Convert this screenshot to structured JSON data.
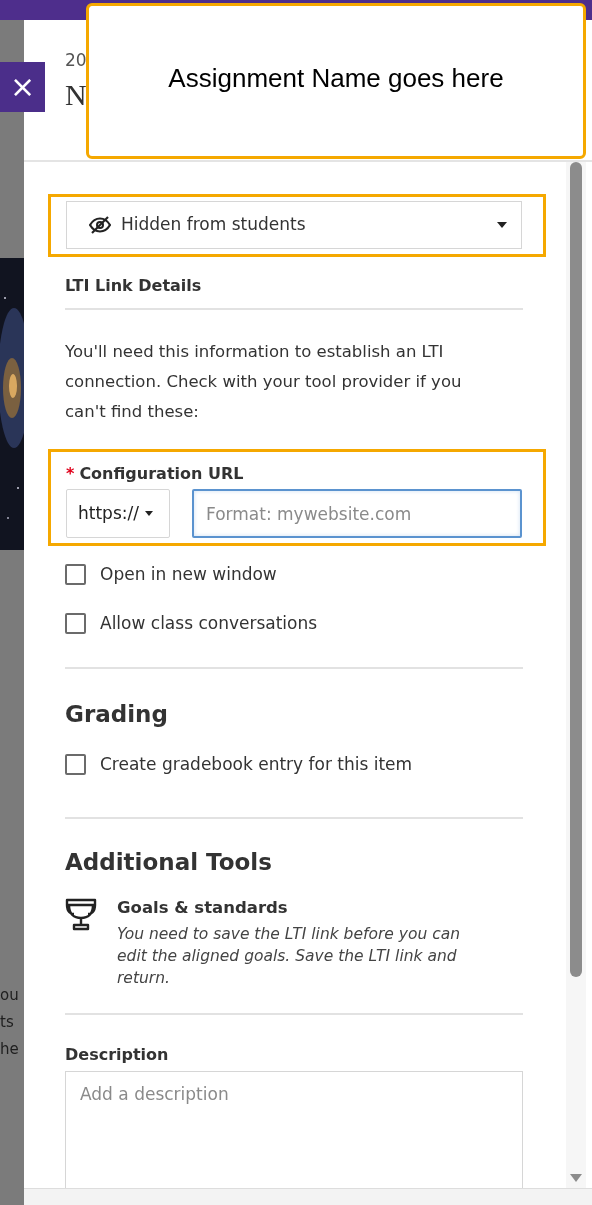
{
  "close_button": {
    "label": "×"
  },
  "background": {
    "fragments": [
      "ou",
      "ts",
      "he"
    ]
  },
  "panel": {
    "date_fragment": "20",
    "title_fragment": "N"
  },
  "callout": {
    "text": "Assignment Name goes here"
  },
  "visibility": {
    "value": "Hidden from students"
  },
  "lti_details": {
    "heading": "LTI Link Details",
    "intro": "You'll need this information to establish an LTI connection. Check with your tool provider if you can't find these:",
    "required_mark": "*",
    "url_label": "Configuration URL",
    "protocol": "https://",
    "url_placeholder": "Format: mywebsite.com"
  },
  "options": [
    {
      "label": "Open in new window",
      "checked": false
    },
    {
      "label": "Allow class conversations",
      "checked": false
    }
  ],
  "grading": {
    "heading": "Grading",
    "options": [
      {
        "label": "Create gradebook entry for this item",
        "checked": false
      }
    ]
  },
  "additional_tools": {
    "heading": "Additional Tools",
    "items": [
      {
        "title": "Goals & standards",
        "note": "You need to save the LTI link before you can edit the aligned goals. Save the LTI link and return."
      }
    ]
  },
  "description": {
    "label": "Description",
    "placeholder": "Add a description"
  }
}
